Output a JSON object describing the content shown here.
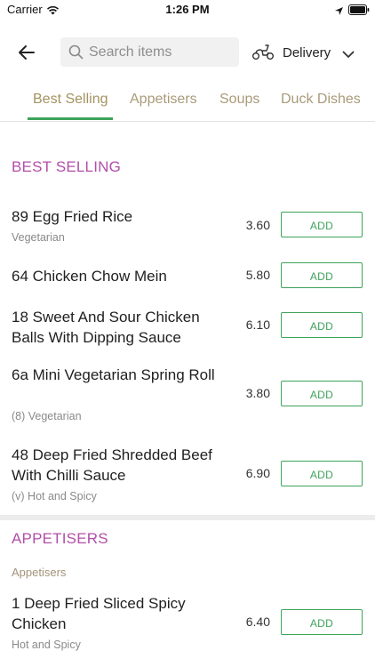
{
  "status_bar": {
    "carrier": "Carrier",
    "time": "1:26 PM"
  },
  "header": {
    "search_placeholder": "Search items",
    "delivery_label": "Delivery"
  },
  "tabs": [
    {
      "label": "Best Selling",
      "active": true
    },
    {
      "label": "Appetisers",
      "active": false
    },
    {
      "label": "Soups",
      "active": false
    },
    {
      "label": "Duck Dishes",
      "active": false
    }
  ],
  "sections": [
    {
      "title": "BEST SELLING",
      "items": [
        {
          "name": "89 Egg Fried Rice",
          "desc": "Vegetarian",
          "price": "3.60",
          "button": "ADD"
        },
        {
          "name": "64 Chicken Chow Mein",
          "desc": "",
          "price": "5.80",
          "button": "ADD"
        },
        {
          "name": "18 Sweet And Sour Chicken Balls With Dipping Sauce",
          "desc": "",
          "price": "6.10",
          "button": "ADD"
        },
        {
          "name": "6a Mini Vegetarian Spring Roll",
          "desc": "(8) Vegetarian",
          "price": "3.80",
          "button": "ADD"
        },
        {
          "name": "48 Deep Fried Shredded Beef With Chilli Sauce",
          "desc": "(v) Hot and Spicy",
          "price": "6.90",
          "button": "ADD"
        }
      ]
    },
    {
      "title": "APPETISERS",
      "subtitle": "Appetisers",
      "items": [
        {
          "name": "1 Deep Fried Sliced Spicy Chicken",
          "desc": "Hot and Spicy",
          "price": "6.40",
          "button": "ADD"
        }
      ]
    }
  ],
  "colors": {
    "accent_green": "#3da35a",
    "section_title": "#b34ea8",
    "tab_text": "#a99a79"
  },
  "icons": [
    "wifi-icon",
    "location-arrow-icon",
    "battery-icon",
    "back-arrow-icon",
    "search-icon",
    "scooter-icon",
    "chevron-down-icon"
  ]
}
